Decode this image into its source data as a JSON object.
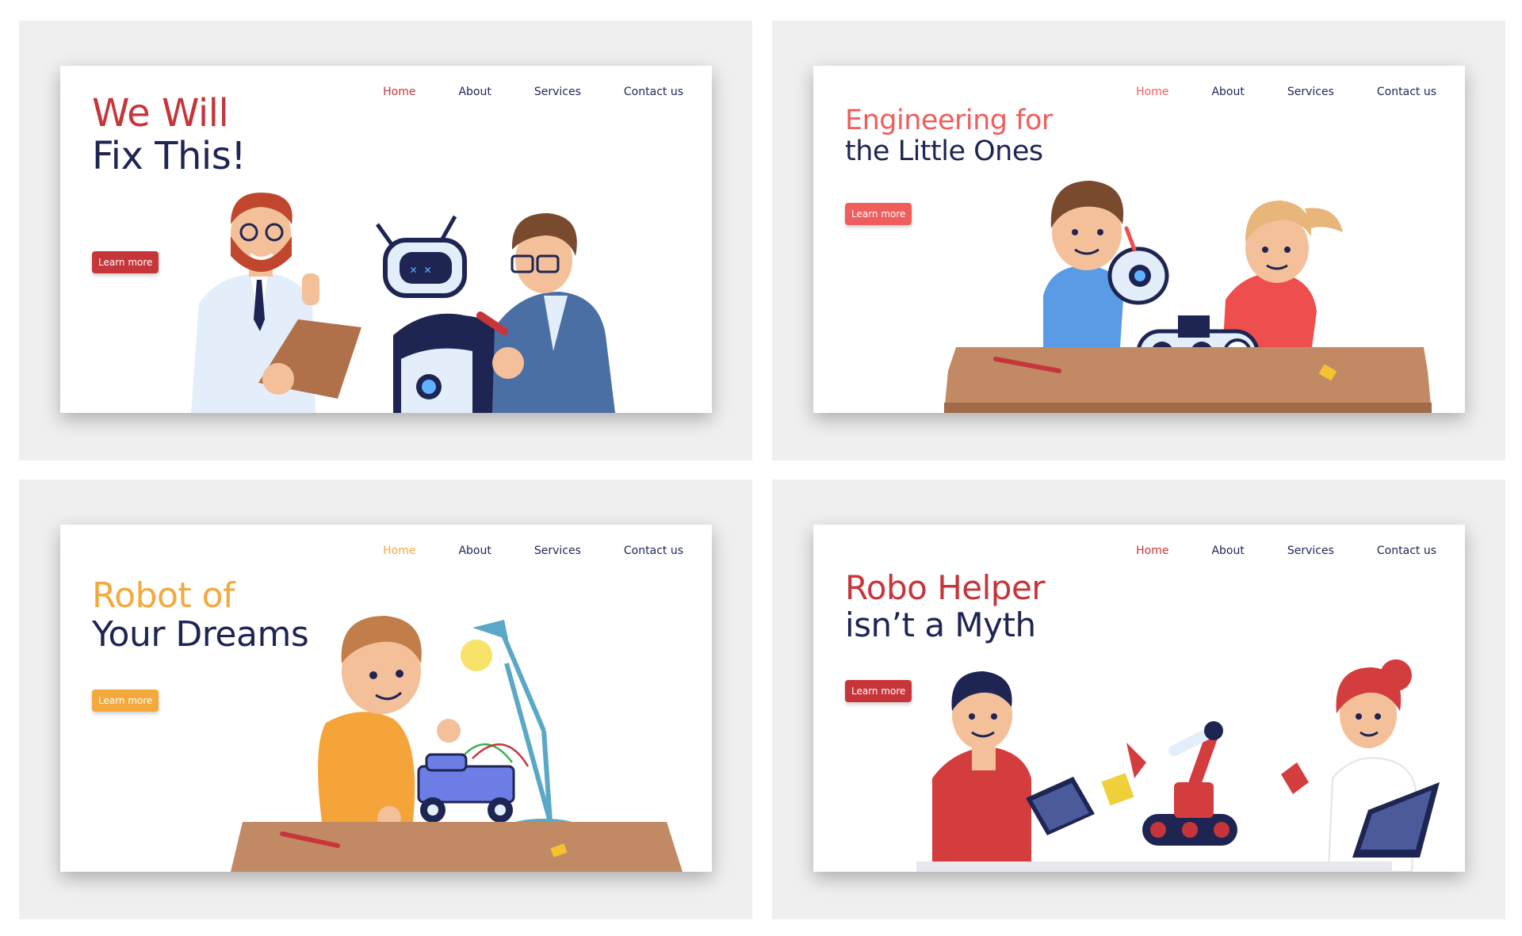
{
  "colors": {
    "red": "#c6353a",
    "coral": "#ef5d5d",
    "orange": "#f4a93c",
    "navy": "#1e2552",
    "panel_bg": "#efefef"
  },
  "panels": [
    {
      "nav": [
        "Home",
        "About",
        "Services",
        "Contact us"
      ],
      "heading_line1": "We Will",
      "heading_line2": "Fix This!",
      "button": "Learn more",
      "accent": "#c6353a"
    },
    {
      "nav": [
        "Home",
        "About",
        "Services",
        "Contact us"
      ],
      "heading_line1": "Engineering for",
      "heading_line2": "the Little Ones",
      "button": "Learn more",
      "accent": "#ef5d5d"
    },
    {
      "nav": [
        "Home",
        "About",
        "Services",
        "Contact us"
      ],
      "heading_line1": "Robot of",
      "heading_line2": "Your Dreams",
      "button": "Learn more",
      "accent": "#f4a93c"
    },
    {
      "nav": [
        "Home",
        "About",
        "Services",
        "Contact us"
      ],
      "heading_line1": "Robo Helper",
      "heading_line2": "isn’t a Myth",
      "button": "Learn more",
      "accent": "#c6353a"
    }
  ]
}
